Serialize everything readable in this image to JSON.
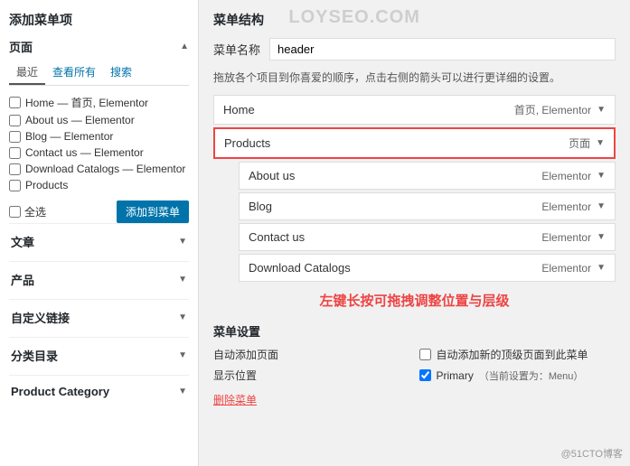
{
  "watermark": "LOYSEO.COM",
  "watermark2": "@51CTO博客",
  "left": {
    "title": "添加菜单项",
    "pages_section": "页面",
    "tabs": [
      "最近",
      "查看所有",
      "搜索"
    ],
    "active_tab": 0,
    "pages": [
      "Home — 首页, Elementor",
      "About us — Elementor",
      "Blog — Elementor",
      "Contact us — Elementor",
      "Download Catalogs — Elementor",
      "Products"
    ],
    "select_all_label": "全选",
    "add_button": "添加到菜单",
    "sections": [
      {
        "label": "文章"
      },
      {
        "label": "产品"
      },
      {
        "label": "自定义链接"
      },
      {
        "label": "分类目录"
      },
      {
        "label": "Product Category"
      }
    ]
  },
  "right": {
    "title": "菜单结构",
    "menu_name_label": "菜单名称",
    "menu_name_value": "header",
    "hint": "拖放各个项目到你喜爱的顺序，点击右侧的箭头可以进行更详细的设置。",
    "menu_items": [
      {
        "label": "Home",
        "meta": "首页, Elementor",
        "sub": false,
        "highlighted": false
      },
      {
        "label": "Products",
        "meta": "页面",
        "sub": false,
        "highlighted": true
      },
      {
        "label": "About us",
        "meta": "Elementor",
        "sub": true,
        "highlighted": false
      },
      {
        "label": "Blog",
        "meta": "Elementor",
        "sub": true,
        "highlighted": false
      },
      {
        "label": "Contact us",
        "meta": "Elementor",
        "sub": true,
        "highlighted": false
      },
      {
        "label": "Download Catalogs",
        "meta": "Elementor",
        "sub": true,
        "highlighted": false
      }
    ],
    "drag_hint": "左键长按可拖拽调整位置与层级",
    "settings": {
      "title": "菜单设置",
      "auto_add_label": "自动添加页面",
      "auto_add_checked": false,
      "auto_add_top_label": "自动添加新的顶级页面到此菜单",
      "auto_add_top_checked": false,
      "display_label": "显示位置",
      "primary_label": "Primary",
      "primary_checked": true,
      "primary_note": "（当前设置为：Menu）"
    },
    "delete_menu": "删除菜单"
  }
}
